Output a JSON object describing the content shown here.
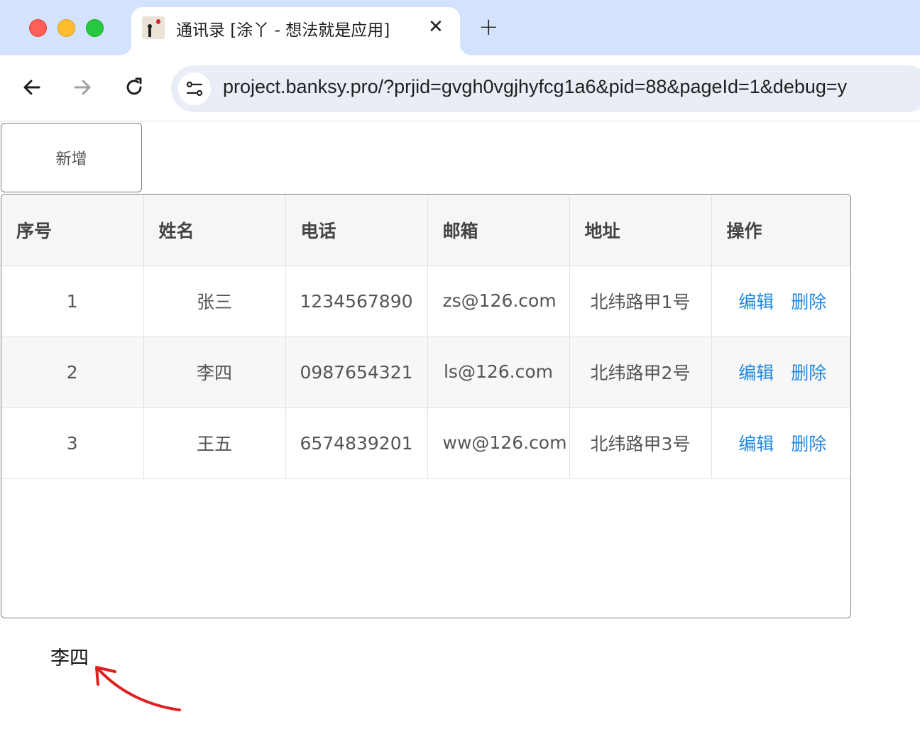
{
  "browser": {
    "tab_title": "通讯录 [涂丫 - 想法就是应用]",
    "tab_close": "✕",
    "new_tab": "+",
    "url": "project.banksy.pro/?prjid=gvgh0vgjhyfcg1a6&pid=88&pageId=1&debug=y"
  },
  "toolbar": {
    "add_label": "新增"
  },
  "table": {
    "headers": [
      "序号",
      "姓名",
      "电话",
      "邮箱",
      "地址",
      "操作"
    ],
    "rows": [
      {
        "index": "1",
        "name": "张三",
        "phone": "1234567890",
        "email": "zs@126.com",
        "address": "北纬路甲1号",
        "edit": "编辑",
        "delete": "删除"
      },
      {
        "index": "2",
        "name": "李四",
        "phone": "0987654321",
        "email": "ls@126.com",
        "address": "北纬路甲2号",
        "edit": "编辑",
        "delete": "删除"
      },
      {
        "index": "3",
        "name": "王五",
        "phone": "6574839201",
        "email": "ww@126.com",
        "address": "北纬路甲3号",
        "edit": "编辑",
        "delete": "删除"
      }
    ]
  },
  "selected": {
    "name": "李四"
  },
  "colors": {
    "tabbar": "#d3e3fd",
    "link": "#1e88e5",
    "annotation_arrow": "#e02020"
  }
}
